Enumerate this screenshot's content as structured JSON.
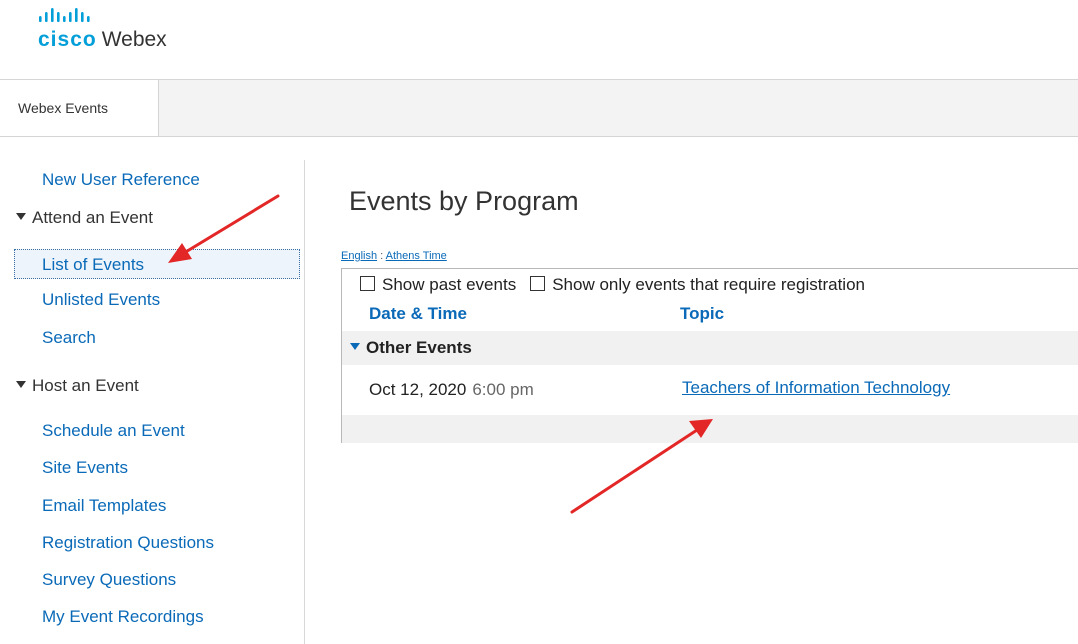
{
  "brand": {
    "cisco": "cisco",
    "product": "Webex",
    "color": "#049fd9"
  },
  "tabs": [
    {
      "label": "Webex Events",
      "active": true
    }
  ],
  "sidebar": {
    "new_user_reference": "New User Reference",
    "attend_section": "Attend an Event",
    "attend_items": [
      {
        "label": "List of Events",
        "active": true
      },
      {
        "label": "Unlisted Events"
      },
      {
        "label": "Search"
      }
    ],
    "host_section": "Host an Event",
    "host_items": [
      {
        "label": "Schedule an Event"
      },
      {
        "label": "Site Events"
      },
      {
        "label": "Email Templates"
      },
      {
        "label": "Registration Questions"
      },
      {
        "label": "Survey Questions"
      },
      {
        "label": "My Event Recordings"
      }
    ]
  },
  "main": {
    "title": "Events by Program",
    "language_link": "English",
    "locale_sep": ":",
    "timezone_link": "Athens Time",
    "filters": {
      "show_past": {
        "label": "Show past events",
        "checked": false
      },
      "show_registration": {
        "label": "Show only events that require registration",
        "checked": false
      }
    },
    "columns": {
      "date_time": "Date & Time",
      "topic": "Topic"
    },
    "group": {
      "name": "Other Events",
      "events": [
        {
          "date": "Oct 12, 2020",
          "time": "6:00 pm",
          "topic": "Teachers of Information Technology"
        }
      ]
    }
  },
  "colors": {
    "link": "#0a6ab8",
    "annotation_arrow": "#e32626"
  }
}
